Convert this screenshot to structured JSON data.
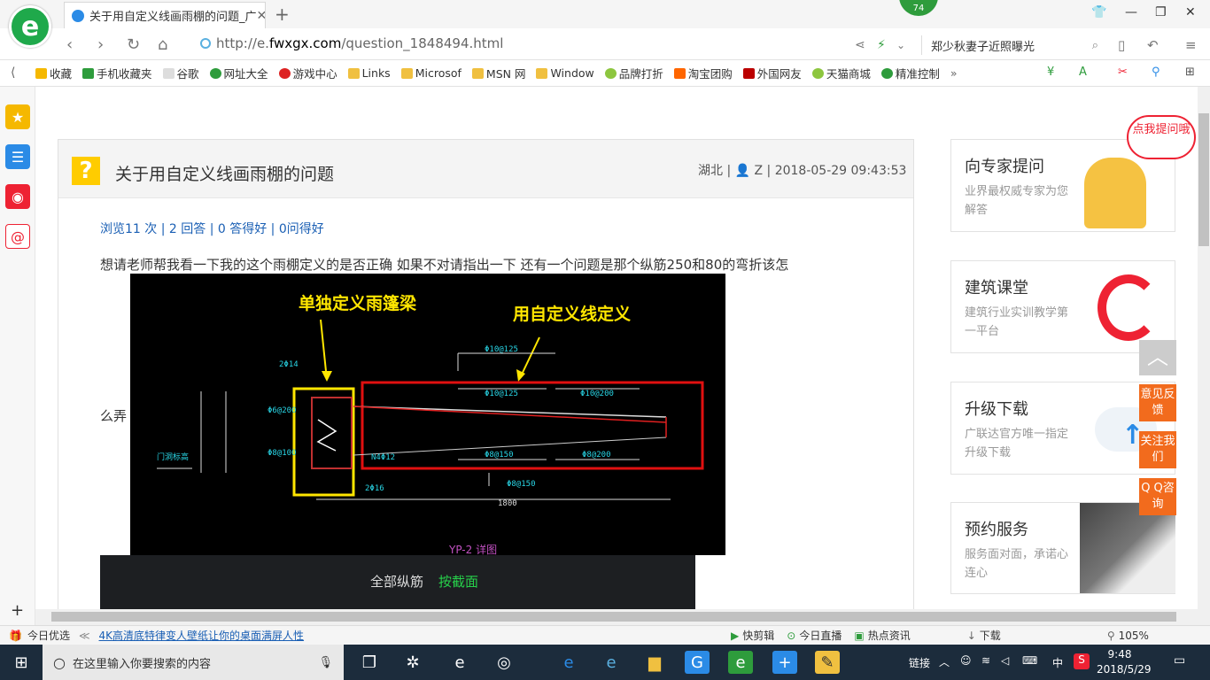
{
  "browser": {
    "tab_title": "关于用自定义线画雨棚的问题_广",
    "url_prefix": "http://e.",
    "url_domain": "fwxgx.com",
    "url_path": "/question_1848494.html",
    "search_text": "郑少秋妻子近照曝光",
    "badge_count": "74"
  },
  "bookmarks": [
    "收藏",
    "手机收藏夹",
    "谷歌",
    "网址大全",
    "游戏中心",
    "Links",
    "Microsof",
    "MSN 网",
    "Window",
    "品牌打折",
    "淘宝团购",
    "外国网友",
    "天猫商城",
    "精准控制"
  ],
  "question": {
    "title": "关于用自定义线画雨棚的问题",
    "meta": "湖北 | 👤 Z | 2018-05-29 09:43:53",
    "stats": "浏览11 次 | 2 回答 | 0 答得好 | 0问得好",
    "body_line1": "想请老师帮我看一下我的这个雨棚定义的是否正确 如果不对请指出一下   还有一个问题是那个纵筋250和80的弯折该怎",
    "body_line2": "么弄"
  },
  "cad": {
    "label_left": "单独定义雨篷梁",
    "label_right": "用自定义线定义",
    "bottom_label_1": "全部纵筋",
    "bottom_label_2": "按截面"
  },
  "sidebar_cards": [
    {
      "title": "向专家提问",
      "sub": "业界最权威专家为您解答"
    },
    {
      "title": "建筑课堂",
      "sub": "建筑行业实训教学第一平台"
    },
    {
      "title": "升级下载",
      "sub": "广联达官方唯一指定升级下载"
    },
    {
      "title": "预约服务",
      "sub": "服务面对面，承诺心连心"
    }
  ],
  "mascot_text": "点我提问哦",
  "float_buttons": [
    "意见反馈",
    "关注我们",
    "Q Q咨询"
  ],
  "statusbar": {
    "left": "今日优选",
    "news": "4K高清底特律变人壁纸让你的桌面满屏人性",
    "items": [
      "快剪辑",
      "今日直播",
      "热点资讯",
      "下载"
    ],
    "zoom": "105%"
  },
  "taskbar": {
    "search_placeholder": "在这里输入你要搜索的内容",
    "link_label": "链接",
    "ime": "中",
    "time": "9:48",
    "date": "2018/5/29"
  },
  "colors": {
    "accent_orange": "#f26b1d",
    "link_blue": "#1a5fb4",
    "yellow_icon": "#ffcc00"
  }
}
